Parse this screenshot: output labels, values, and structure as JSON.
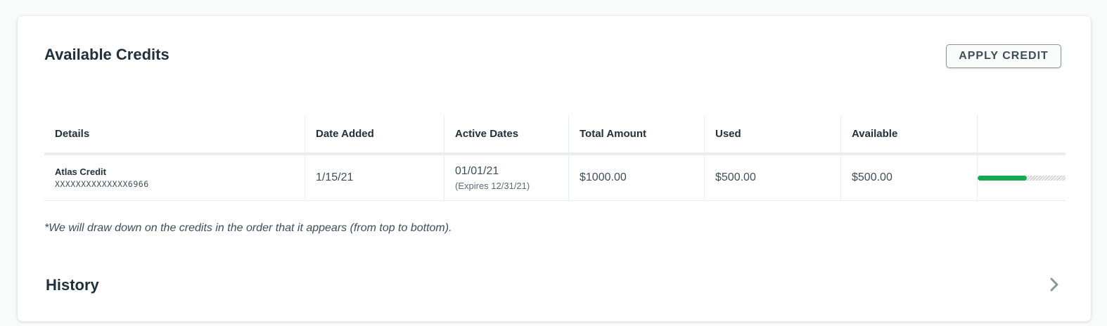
{
  "card": {
    "title": "Available Credits",
    "apply_button": "APPLY CREDIT"
  },
  "table": {
    "headers": [
      "Details",
      "Date Added",
      "Active Dates",
      "Total Amount",
      "Used",
      "Available"
    ],
    "rows": [
      {
        "name": "Atlas Credit",
        "id": "XXXXXXXXXXXXXX6966",
        "date_added": "1/15/21",
        "active_start": "01/01/21",
        "active_expires": "(Expires 12/31/21)",
        "total_amount": "$1000.00",
        "used": "$500.00",
        "available": "$500.00",
        "used_fraction": 0.56
      }
    ]
  },
  "footnote": "*We will draw down on the credits in the order that it appears (from top to bottom).",
  "history": {
    "title": "History"
  },
  "icons": {
    "history_expand": "chevron-right-icon"
  },
  "colors": {
    "progress_fill": "#13aa52",
    "progress_track": "#c1c7c6",
    "chevron": "#89979b"
  }
}
